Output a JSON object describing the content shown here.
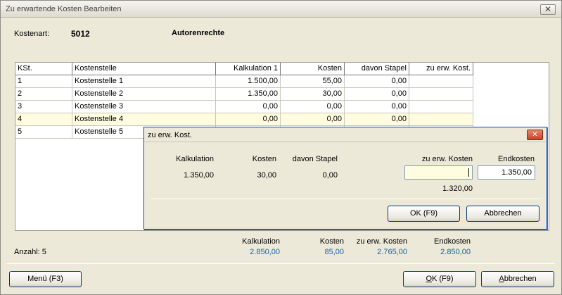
{
  "window": {
    "title": "Zu erwartende Kosten Bearbeiten",
    "close_glyph": "✕"
  },
  "header": {
    "kostenart_label": "Kostenart:",
    "kostenart_code": "5012",
    "kostenart_name": "Autorenrechte"
  },
  "table": {
    "columns": [
      "KSt.",
      "Kostenstelle",
      "Kalkulation 1",
      "Kosten",
      "davon Stapel",
      "zu erw. Kost."
    ],
    "rows": [
      [
        "1",
        "Kostenstelle 1",
        "1.500,00",
        "55,00",
        "0,00",
        ""
      ],
      [
        "2",
        "Kostenstelle 2",
        "1.350,00",
        "30,00",
        "0,00",
        ""
      ],
      [
        "3",
        "Kostenstelle 3",
        "0,00",
        "0,00",
        "0,00",
        ""
      ],
      [
        "4",
        "Kostenstelle 4",
        "0,00",
        "0,00",
        "0,00",
        ""
      ],
      [
        "5",
        "Kostenstelle 5",
        "",
        "",
        "",
        ""
      ]
    ],
    "selected_row": 4
  },
  "dialog": {
    "title": "zu erw. Kost.",
    "close_glyph": "✕",
    "labels": {
      "kalkulation": "Kalkulation",
      "kosten": "Kosten",
      "stapel": "davon Stapel",
      "zu_erw": "zu erw. Kosten",
      "endkosten": "Endkosten"
    },
    "values": {
      "kalkulation": "1.350,00",
      "kosten": "30,00",
      "stapel": "0,00",
      "zu_erw_input": "",
      "endkosten_input": "1.350,00",
      "zu_erw_hint": "1.320,00"
    },
    "ok_label": "OK (F9)",
    "cancel_label": "Abbrechen"
  },
  "summary": {
    "count_label": "Anzahl: 5",
    "labels": {
      "kalkulation": "Kalkulation",
      "kosten": "Kosten",
      "zu_erw": "zu erw. Kosten",
      "endkosten": "Endkosten"
    },
    "values": {
      "kalkulation": "2.850,00",
      "kosten": "85,00",
      "zu_erw": "2.765,00",
      "endkosten": "2.850,00"
    }
  },
  "footer": {
    "menu_label": "Menü (F3)",
    "ok_prefix": "",
    "ok_u": "O",
    "ok_rest": "K (F9)",
    "cancel_u": "A",
    "cancel_rest": "bbrechen"
  },
  "colors": {
    "accent_blue": "#1f5fa8",
    "selected_row": "#fffce0",
    "dialog_border": "#0b47c7"
  }
}
